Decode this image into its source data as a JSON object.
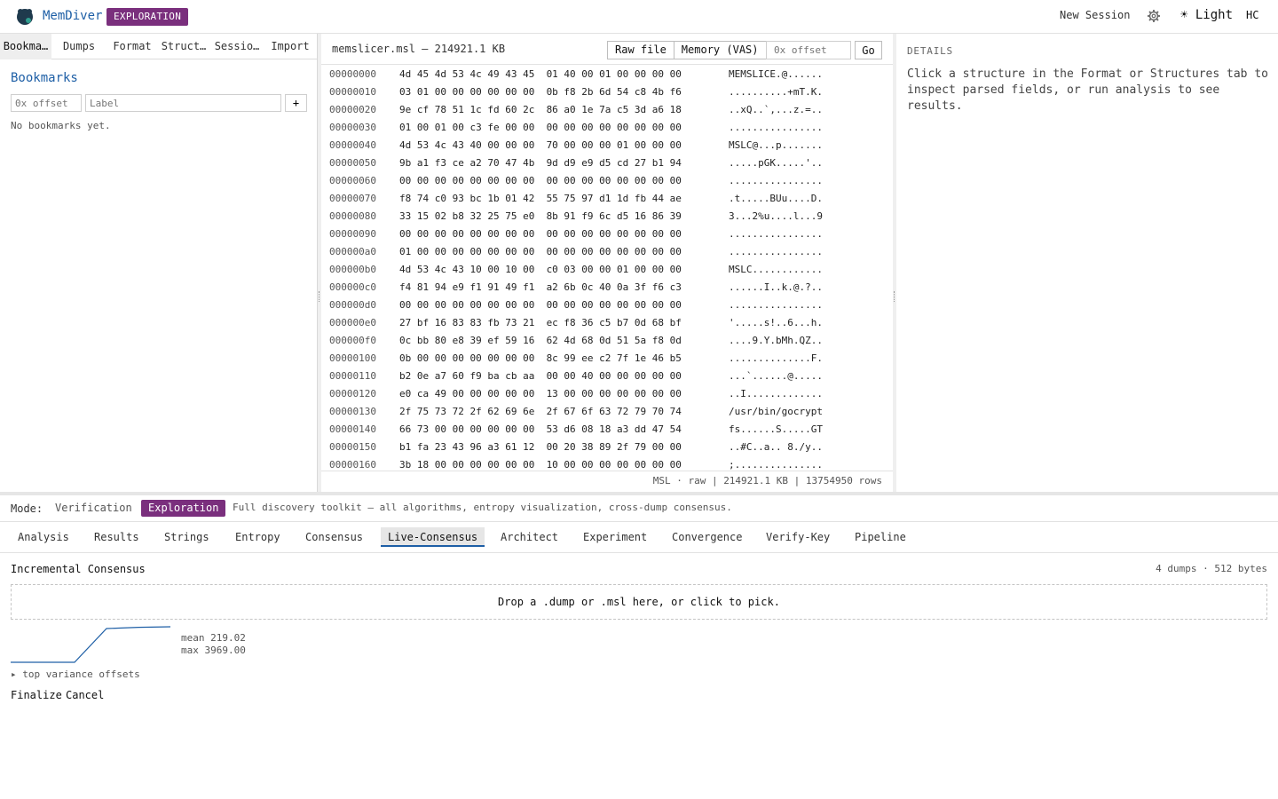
{
  "header": {
    "app_title": "MemDiver",
    "mode_badge": "EXPLORATION",
    "new_session": "New Session",
    "settings_icon": "gear-icon",
    "theme_toggle": "☀ Light",
    "hc_toggle": "HC"
  },
  "left_panel": {
    "tabs": [
      {
        "label": "Bookma…",
        "active": true
      },
      {
        "label": "Dumps",
        "active": false
      },
      {
        "label": "Format",
        "active": false
      },
      {
        "label": "Struct…",
        "active": false
      },
      {
        "label": "Sessio…",
        "active": false
      },
      {
        "label": "Import",
        "active": false
      }
    ],
    "bookmarks_title": "Bookmarks",
    "offset_placeholder": "0x offset",
    "label_placeholder": "Label",
    "add_label": "+",
    "empty_text": "No bookmarks yet."
  },
  "hex_view": {
    "file_label": "memslicer.msl — 214921.1 KB",
    "view_buttons": [
      "Raw file",
      "Memory (VAS)"
    ],
    "goto_placeholder": "0x offset",
    "go_label": "Go",
    "rows": [
      {
        "offset": "00000000",
        "hex": "4d 45 4d 53 4c 49 43 45  01 40 00 01 00 00 00 00",
        "ascii": "MEMSLICE.@......"
      },
      {
        "offset": "00000010",
        "hex": "03 01 00 00 00 00 00 00  0b f8 2b 6d 54 c8 4b f6",
        "ascii": "..........+mT.K."
      },
      {
        "offset": "00000020",
        "hex": "9e cf 78 51 1c fd 60 2c  86 a0 1e 7a c5 3d a6 18",
        "ascii": "..xQ..`,...z.=.."
      },
      {
        "offset": "00000030",
        "hex": "01 00 01 00 c3 fe 00 00  00 00 00 00 00 00 00 00",
        "ascii": "................"
      },
      {
        "offset": "00000040",
        "hex": "4d 53 4c 43 40 00 00 00  70 00 00 00 01 00 00 00",
        "ascii": "MSLC@...p......."
      },
      {
        "offset": "00000050",
        "hex": "9b a1 f3 ce a2 70 47 4b  9d d9 e9 d5 cd 27 b1 94",
        "ascii": ".....pGK.....'.."
      },
      {
        "offset": "00000060",
        "hex": "00 00 00 00 00 00 00 00  00 00 00 00 00 00 00 00",
        "ascii": "................"
      },
      {
        "offset": "00000070",
        "hex": "f8 74 c0 93 bc 1b 01 42  55 75 97 d1 1d fb 44 ae",
        "ascii": ".t.....BUu....D."
      },
      {
        "offset": "00000080",
        "hex": "33 15 02 b8 32 25 75 e0  8b 91 f9 6c d5 16 86 39",
        "ascii": "3...2%u....l...9"
      },
      {
        "offset": "00000090",
        "hex": "00 00 00 00 00 00 00 00  00 00 00 00 00 00 00 00",
        "ascii": "................"
      },
      {
        "offset": "000000a0",
        "hex": "01 00 00 00 00 00 00 00  00 00 00 00 00 00 00 00",
        "ascii": "................"
      },
      {
        "offset": "000000b0",
        "hex": "4d 53 4c 43 10 00 10 00  c0 03 00 00 01 00 00 00",
        "ascii": "MSLC............"
      },
      {
        "offset": "000000c0",
        "hex": "f4 81 94 e9 f1 91 49 f1  a2 6b 0c 40 0a 3f f6 c3",
        "ascii": "......I..k.@.?.."
      },
      {
        "offset": "000000d0",
        "hex": "00 00 00 00 00 00 00 00  00 00 00 00 00 00 00 00",
        "ascii": "................"
      },
      {
        "offset": "000000e0",
        "hex": "27 bf 16 83 83 fb 73 21  ec f8 36 c5 b7 0d 68 bf",
        "ascii": "'.....s!..6...h."
      },
      {
        "offset": "000000f0",
        "hex": "0c bb 80 e8 39 ef 59 16  62 4d 68 0d 51 5a f8 0d",
        "ascii": "....9.Y.bMh.QZ.."
      },
      {
        "offset": "00000100",
        "hex": "0b 00 00 00 00 00 00 00  8c 99 ee c2 7f 1e 46 b5",
        "ascii": "..............F."
      },
      {
        "offset": "00000110",
        "hex": "b2 0e a7 60 f9 ba cb aa  00 00 40 00 00 00 00 00",
        "ascii": "...`......@....."
      },
      {
        "offset": "00000120",
        "hex": "e0 ca 49 00 00 00 00 00  13 00 00 00 00 00 00 00",
        "ascii": "..I............."
      },
      {
        "offset": "00000130",
        "hex": "2f 75 73 72 2f 62 69 6e  2f 67 6f 63 72 79 70 74",
        "ascii": "/usr/bin/gocrypt"
      },
      {
        "offset": "00000140",
        "hex": "66 73 00 00 00 00 00 00  53 d6 08 18 a3 dd 47 54",
        "ascii": "fs......S.....GT"
      },
      {
        "offset": "00000150",
        "hex": "b1 fa 23 43 96 a3 61 12  00 20 38 89 2f 79 00 00",
        "ascii": "..#C..a.. 8./y.."
      },
      {
        "offset": "00000160",
        "hex": "3b 18 00 00 00 00 00 00  10 00 00 00 00 00 00 00",
        "ascii": ";..............."
      }
    ],
    "status": "MSL · raw | 214921.1 KB | 13754950 rows"
  },
  "details": {
    "title": "DETAILS",
    "text": "Click a structure in the Format or Structures tab to inspect parsed fields, or run analysis to see results."
  },
  "mode_bar": {
    "label": "Mode:",
    "options": [
      {
        "label": "Verification",
        "active": false
      },
      {
        "label": "Exploration",
        "active": true
      }
    ],
    "description": "Full discovery toolkit — all algorithms, entropy visualization, cross-dump consensus."
  },
  "analysis_tabs": [
    {
      "label": "Analysis",
      "active": false
    },
    {
      "label": "Results",
      "active": false
    },
    {
      "label": "Strings",
      "active": false
    },
    {
      "label": "Entropy",
      "active": false
    },
    {
      "label": "Consensus",
      "active": false
    },
    {
      "label": "Live-Consensus",
      "active": true
    },
    {
      "label": "Architect",
      "active": false
    },
    {
      "label": "Experiment",
      "active": false
    },
    {
      "label": "Convergence",
      "active": false
    },
    {
      "label": "Verify-Key",
      "active": false
    },
    {
      "label": "Pipeline",
      "active": false
    }
  ],
  "incremental": {
    "title": "Incremental Consensus",
    "meta": "4 dumps · 512 bytes",
    "dropzone": "Drop a .dump or .msl here, or click to pick.",
    "sparkline_values": [
      0,
      0,
      0,
      2600,
      2700,
      2740
    ],
    "sparkline_max": 2740,
    "mean": "mean 219.02",
    "max": "max 3969.00",
    "variance_toggle": "▸ top variance offsets",
    "finalize": "Finalize",
    "cancel": "Cancel"
  },
  "colors": {
    "brand_blue": "#1e5fa6",
    "exploration_purple": "#7a2f7d"
  }
}
